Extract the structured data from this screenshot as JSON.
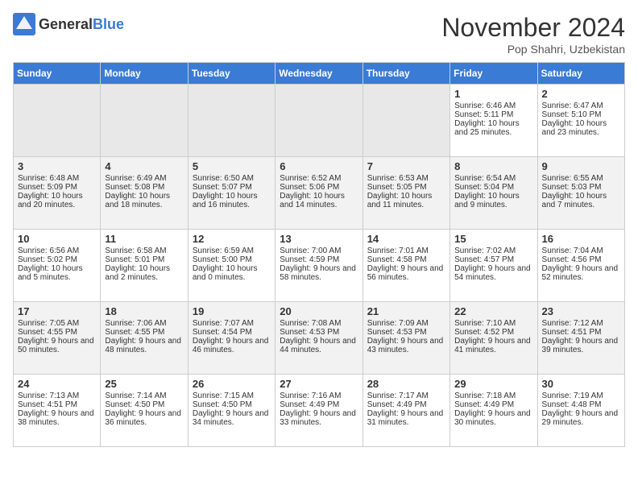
{
  "header": {
    "logo_general": "General",
    "logo_blue": "Blue",
    "month_title": "November 2024",
    "location": "Pop Shahri, Uzbekistan"
  },
  "days_of_week": [
    "Sunday",
    "Monday",
    "Tuesday",
    "Wednesday",
    "Thursday",
    "Friday",
    "Saturday"
  ],
  "weeks": [
    [
      {
        "day": "",
        "info": ""
      },
      {
        "day": "",
        "info": ""
      },
      {
        "day": "",
        "info": ""
      },
      {
        "day": "",
        "info": ""
      },
      {
        "day": "",
        "info": ""
      },
      {
        "day": "1",
        "info": "Sunrise: 6:46 AM\nSunset: 5:11 PM\nDaylight: 10 hours and 25 minutes."
      },
      {
        "day": "2",
        "info": "Sunrise: 6:47 AM\nSunset: 5:10 PM\nDaylight: 10 hours and 23 minutes."
      }
    ],
    [
      {
        "day": "3",
        "info": "Sunrise: 6:48 AM\nSunset: 5:09 PM\nDaylight: 10 hours and 20 minutes."
      },
      {
        "day": "4",
        "info": "Sunrise: 6:49 AM\nSunset: 5:08 PM\nDaylight: 10 hours and 18 minutes."
      },
      {
        "day": "5",
        "info": "Sunrise: 6:50 AM\nSunset: 5:07 PM\nDaylight: 10 hours and 16 minutes."
      },
      {
        "day": "6",
        "info": "Sunrise: 6:52 AM\nSunset: 5:06 PM\nDaylight: 10 hours and 14 minutes."
      },
      {
        "day": "7",
        "info": "Sunrise: 6:53 AM\nSunset: 5:05 PM\nDaylight: 10 hours and 11 minutes."
      },
      {
        "day": "8",
        "info": "Sunrise: 6:54 AM\nSunset: 5:04 PM\nDaylight: 10 hours and 9 minutes."
      },
      {
        "day": "9",
        "info": "Sunrise: 6:55 AM\nSunset: 5:03 PM\nDaylight: 10 hours and 7 minutes."
      }
    ],
    [
      {
        "day": "10",
        "info": "Sunrise: 6:56 AM\nSunset: 5:02 PM\nDaylight: 10 hours and 5 minutes."
      },
      {
        "day": "11",
        "info": "Sunrise: 6:58 AM\nSunset: 5:01 PM\nDaylight: 10 hours and 2 minutes."
      },
      {
        "day": "12",
        "info": "Sunrise: 6:59 AM\nSunset: 5:00 PM\nDaylight: 10 hours and 0 minutes."
      },
      {
        "day": "13",
        "info": "Sunrise: 7:00 AM\nSunset: 4:59 PM\nDaylight: 9 hours and 58 minutes."
      },
      {
        "day": "14",
        "info": "Sunrise: 7:01 AM\nSunset: 4:58 PM\nDaylight: 9 hours and 56 minutes."
      },
      {
        "day": "15",
        "info": "Sunrise: 7:02 AM\nSunset: 4:57 PM\nDaylight: 9 hours and 54 minutes."
      },
      {
        "day": "16",
        "info": "Sunrise: 7:04 AM\nSunset: 4:56 PM\nDaylight: 9 hours and 52 minutes."
      }
    ],
    [
      {
        "day": "17",
        "info": "Sunrise: 7:05 AM\nSunset: 4:55 PM\nDaylight: 9 hours and 50 minutes."
      },
      {
        "day": "18",
        "info": "Sunrise: 7:06 AM\nSunset: 4:55 PM\nDaylight: 9 hours and 48 minutes."
      },
      {
        "day": "19",
        "info": "Sunrise: 7:07 AM\nSunset: 4:54 PM\nDaylight: 9 hours and 46 minutes."
      },
      {
        "day": "20",
        "info": "Sunrise: 7:08 AM\nSunset: 4:53 PM\nDaylight: 9 hours and 44 minutes."
      },
      {
        "day": "21",
        "info": "Sunrise: 7:09 AM\nSunset: 4:53 PM\nDaylight: 9 hours and 43 minutes."
      },
      {
        "day": "22",
        "info": "Sunrise: 7:10 AM\nSunset: 4:52 PM\nDaylight: 9 hours and 41 minutes."
      },
      {
        "day": "23",
        "info": "Sunrise: 7:12 AM\nSunset: 4:51 PM\nDaylight: 9 hours and 39 minutes."
      }
    ],
    [
      {
        "day": "24",
        "info": "Sunrise: 7:13 AM\nSunset: 4:51 PM\nDaylight: 9 hours and 38 minutes."
      },
      {
        "day": "25",
        "info": "Sunrise: 7:14 AM\nSunset: 4:50 PM\nDaylight: 9 hours and 36 minutes."
      },
      {
        "day": "26",
        "info": "Sunrise: 7:15 AM\nSunset: 4:50 PM\nDaylight: 9 hours and 34 minutes."
      },
      {
        "day": "27",
        "info": "Sunrise: 7:16 AM\nSunset: 4:49 PM\nDaylight: 9 hours and 33 minutes."
      },
      {
        "day": "28",
        "info": "Sunrise: 7:17 AM\nSunset: 4:49 PM\nDaylight: 9 hours and 31 minutes."
      },
      {
        "day": "29",
        "info": "Sunrise: 7:18 AM\nSunset: 4:49 PM\nDaylight: 9 hours and 30 minutes."
      },
      {
        "day": "30",
        "info": "Sunrise: 7:19 AM\nSunset: 4:48 PM\nDaylight: 9 hours and 29 minutes."
      }
    ]
  ]
}
